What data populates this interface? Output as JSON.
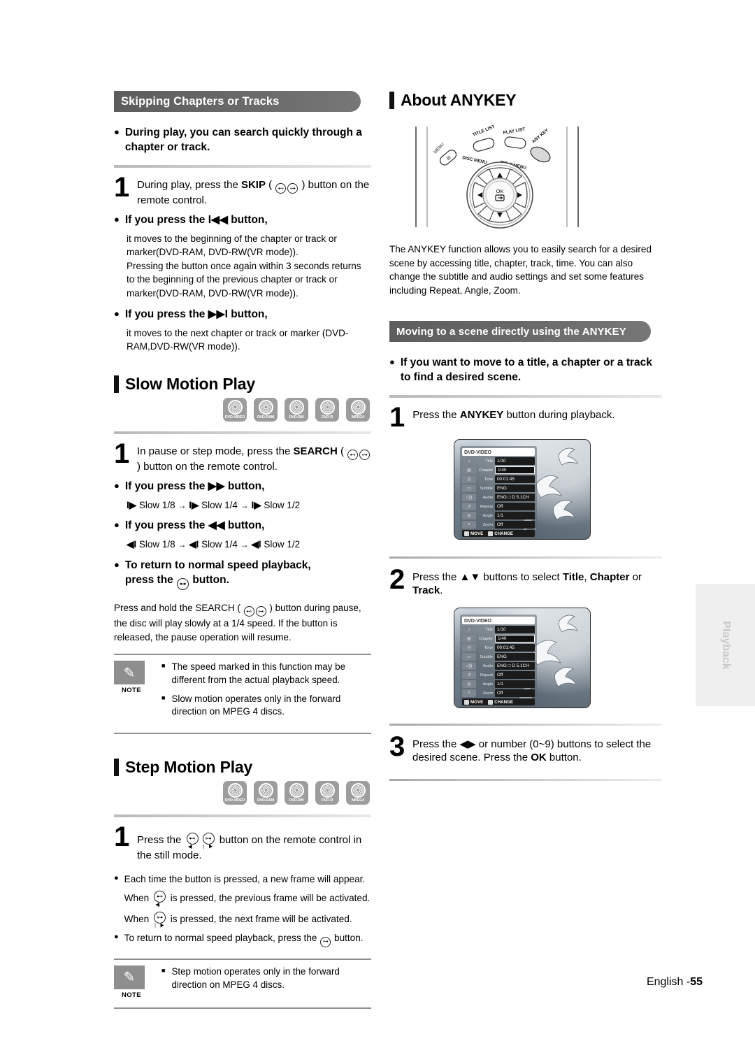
{
  "page": {
    "footer_label": "English -",
    "footer_page": "55",
    "side_tab": "Playback"
  },
  "left_column": {
    "banner": "Skipping Chapters or Tracks",
    "intro_bullet": "During play, you can search quickly through a chapter or track.",
    "step1": {
      "number": "1",
      "text_before": "During play, press the ",
      "bold": "SKIP",
      "text_mid": " ( ",
      "text_after": " ) button on the remote control."
    },
    "press_prev": {
      "heading_before": "If you press the ",
      "heading_glyph": "I◀◀",
      "heading_after": " button,",
      "body": "it moves to the beginning of the chapter or track or marker(DVD-RAM, DVD-RW(VR mode)).\nPressing the button once again within 3 seconds returns to the beginning of the previous chapter or track or marker(DVD-RAM, DVD-RW(VR mode))."
    },
    "press_next": {
      "heading_before": "If you press the ",
      "heading_glyph": "▶▶I",
      "heading_after": " button,",
      "body": "it moves to the next chapter or track or marker (DVD-RAM,DVD-RW(VR mode))."
    },
    "slow_motion": {
      "title": "Slow Motion Play",
      "discs": [
        "DVD-VIDEO",
        "DVD-RAM",
        "DVD-RW",
        "DVD-R",
        "MPEG4"
      ],
      "step1": {
        "number": "1",
        "text_before": "In pause or step mode, press the ",
        "bold": "SEARCH",
        "text_mid": " ( ",
        "text_after": " ) button on the remote control."
      },
      "forward": {
        "heading_before": "If you press the ",
        "heading_glyph": "▶▶",
        "heading_after": " button,",
        "speeds": "Slow 1/8 → Slow 1/4 → Slow 1/2",
        "speed_glyph": "I▶",
        "s1": "Slow 1/8",
        "s2": "Slow 1/4",
        "s3": "Slow 1/2"
      },
      "reverse": {
        "heading_before": "If you press the ",
        "heading_glyph": "◀◀",
        "heading_after": " button,",
        "speed_glyph": "◀I",
        "s1": "Slow 1/8",
        "s2": "Slow 1/4",
        "s3": "Slow 1/2"
      },
      "normal": {
        "line1": "To return to normal speed playback,",
        "line2_before": "press the ",
        "line2_after": " button."
      },
      "hold_note": "Press and hold the SEARCH (  ) button during pause, the disc will play slowly at a 1/4 speed. If the button is released, the pause operation will resume.",
      "hold_note_pre": "Press and hold the SEARCH ( ",
      "hold_note_post": " ) button during pause, the disc will play slowly at a 1/4 speed. If the button is released, the pause operation will resume.",
      "note": {
        "caption": "NOTE",
        "items": [
          "The speed marked in this function may be different from the actual playback speed.",
          "Slow motion operates only in the forward direction on MPEG 4 discs."
        ]
      }
    },
    "step_motion": {
      "title": "Step Motion Play",
      "discs": [
        "DVD-VIDEO",
        "DVD-RAM",
        "DVD-RW",
        "DVD-R",
        "MPEG4"
      ],
      "step1": {
        "number": "1",
        "text_before": "Press the ",
        "text_after": " button on the remote control in the still mode."
      },
      "bullets": {
        "b1_line1": "Each time the button is pressed, a new frame will appear.",
        "b1_when1_pre": "When ",
        "b1_when1_post": " is pressed, the previous frame will be activated.",
        "b1_when2_pre": "When ",
        "b1_when2_post": " is pressed, the next frame will be activated.",
        "b2_pre": "To return to normal speed playback, press the ",
        "b2_post": " button."
      },
      "note": {
        "caption": "NOTE",
        "items": [
          "Step motion operates only in the forward direction on MPEG 4 discs."
        ]
      }
    }
  },
  "right_column": {
    "about": {
      "title": "About ANYKEY",
      "remote_labels": {
        "menu": "MENU",
        "title_list": "TITLE LIST",
        "play_list": "PLAY LIST",
        "any_key": "ANY KEY",
        "disc_menu": "DISC MENU",
        "title_menu": "TITLE MENU",
        "ok": "OK"
      },
      "paragraph": "The ANYKEY function allows you to easily search for a desired scene by accessing title, chapter, track, time. You can also change the subtitle and audio settings and set some features including Repeat, Angle, Zoom."
    },
    "moving_banner": "Moving to a scene directly using the ANYKEY",
    "moving_bullet": "If you want to move to a title, a chapter or a track to find a desired scene.",
    "step1": {
      "number": "1",
      "text_before": "Press the ",
      "bold": "ANYKEY",
      "text_after": " button during playback."
    },
    "step2": {
      "number": "2",
      "text_before": "Press the ",
      "glyph": "▲▼",
      "text_mid": " buttons to select ",
      "bold1": "Title",
      "comma": ", ",
      "bold2": "Chapter",
      "or": " or ",
      "bold3": "Track",
      "period": "."
    },
    "step3": {
      "number": "3",
      "text_before": "Press the ",
      "glyph": "◀▶",
      "text_mid": " or number (0~9) buttons to select the desired scene. Press the ",
      "bold": "OK",
      "text_after": " button."
    },
    "osd1": {
      "header": "DVD-VIDEO",
      "rows": [
        {
          "name": "Title",
          "value": "1/10",
          "selected": false,
          "icon": "♪"
        },
        {
          "name": "Chapter",
          "value": "1/40",
          "selected": true,
          "icon": "▤"
        },
        {
          "name": "Time",
          "value": "00:01:45",
          "selected": false,
          "icon": "◷"
        },
        {
          "name": "Subtitle",
          "value": "ENG",
          "selected": false,
          "icon": "▭"
        },
        {
          "name": "Audio",
          "value": "ENG □ D 5.1CH",
          "selected": false,
          "icon": "◁"
        },
        {
          "name": "Repeat",
          "value": "Off",
          "selected": false,
          "icon": "↺"
        },
        {
          "name": "Angle",
          "value": "1/1",
          "selected": false,
          "icon": "◎"
        },
        {
          "name": "Zoom",
          "value": "Off",
          "selected": false,
          "icon": "⌕"
        }
      ],
      "foot_move": "MOVE",
      "foot_change": "CHANGE"
    },
    "osd2": {
      "header": "DVD-VIDEO",
      "rows": [
        {
          "name": "Title",
          "value": "1/10",
          "selected": false,
          "icon": "♪"
        },
        {
          "name": "Chapter",
          "value": "1/40",
          "selected": true,
          "icon": "▤"
        },
        {
          "name": "Time",
          "value": "00:01:45",
          "selected": false,
          "icon": "◷"
        },
        {
          "name": "Subtitle",
          "value": "ENG",
          "selected": false,
          "icon": "▭"
        },
        {
          "name": "Audio",
          "value": "ENG □ D 5.1CH",
          "selected": false,
          "icon": "◁"
        },
        {
          "name": "Repeat",
          "value": "Off",
          "selected": false,
          "icon": "↺"
        },
        {
          "name": "Angle",
          "value": "1/1",
          "selected": false,
          "icon": "◎"
        },
        {
          "name": "Zoom",
          "value": "Off",
          "selected": false,
          "icon": "⌕"
        }
      ],
      "foot_move": "MOVE",
      "foot_change": "CHANGE"
    }
  }
}
